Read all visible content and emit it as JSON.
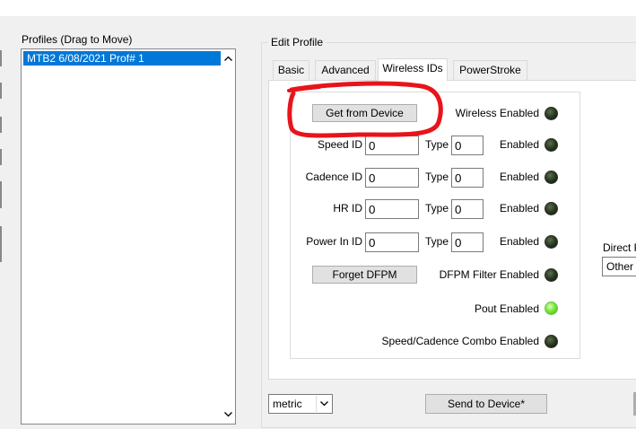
{
  "profiles": {
    "label": "Profiles (Drag to Move)",
    "items": [
      "MTB2 6/08/2021 Prof# 1"
    ]
  },
  "edit_profile": {
    "label": "Edit Profile",
    "tabs": [
      "Basic",
      "Advanced",
      "Wireless IDs",
      "PowerStroke"
    ],
    "active_tab": "Wireless IDs"
  },
  "wireless": {
    "get_from_device_label": "Get from Device",
    "wireless_enabled_label": "Wireless Enabled",
    "rows": [
      {
        "label": "Speed ID",
        "id_value": "0",
        "type_label": "Type",
        "type_value": "0",
        "enabled_label": "Enabled",
        "enabled": false
      },
      {
        "label": "Cadence ID",
        "id_value": "0",
        "type_label": "Type",
        "type_value": "0",
        "enabled_label": "Enabled",
        "enabled": false
      },
      {
        "label": "HR ID",
        "id_value": "0",
        "type_label": "Type",
        "type_value": "0",
        "enabled_label": "Enabled",
        "enabled": false
      },
      {
        "label": "Power In ID",
        "id_value": "0",
        "type_label": "Type",
        "type_value": "0",
        "enabled_label": "Enabled",
        "enabled": false
      }
    ],
    "forget_dfpm_label": "Forget DFPM",
    "dfpm_filter_label": "DFPM Filter Enabled",
    "pout_label": "Pout Enabled",
    "combo_label": "Speed/Cadence Combo Enabled",
    "indicators": {
      "wireless_enabled": false,
      "dfpm_filter_enabled": false,
      "pout_enabled": true,
      "combo_enabled": false
    }
  },
  "right": {
    "direct_label": "Direct F",
    "direct_value": "Other"
  },
  "footer": {
    "units_value": "metric",
    "send_label": "Send to Device*"
  },
  "colors": {
    "selection": "#0078d7",
    "led_on": "#7ee83c",
    "led_off": "#26331e",
    "annotation": "#e8141a"
  }
}
